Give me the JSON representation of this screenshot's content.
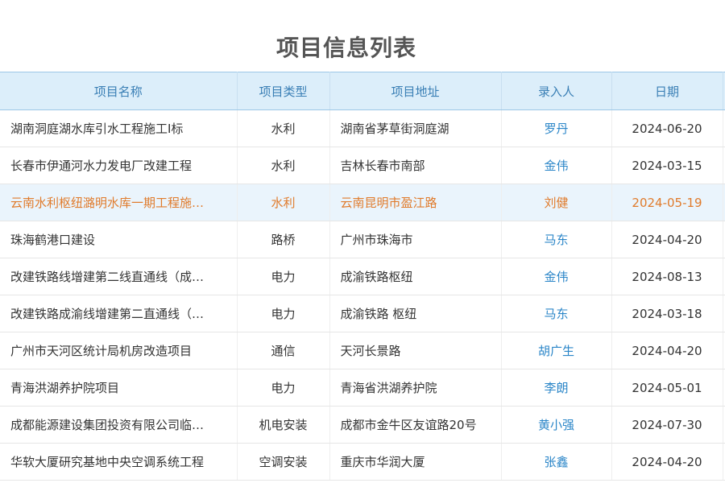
{
  "page": {
    "title": "项目信息列表"
  },
  "table": {
    "headers": [
      "项目名称",
      "项目类型",
      "项目地址",
      "录入人",
      "日期"
    ],
    "rows": [
      {
        "name": "湖南洞庭湖水库引水工程施工I标",
        "type": "水利",
        "address": "湖南省茅草街洞庭湖",
        "person": "罗丹",
        "date": "2024-06-20"
      },
      {
        "name": "长春市伊通河水力发电厂改建工程",
        "type": "水利",
        "address": "吉林长春市南部",
        "person": "金伟",
        "date": "2024-03-15"
      },
      {
        "name": "云南水利枢纽潞明水库一期工程施…",
        "type": "水利",
        "address": "云南昆明市盈江路",
        "person": "刘健",
        "date": "2024-05-19"
      },
      {
        "name": "珠海鹤港口建设",
        "type": "路桥",
        "address": "广州市珠海市",
        "person": "马东",
        "date": "2024-04-20"
      },
      {
        "name": "改建铁路线增建第二线直通线（成…",
        "type": "电力",
        "address": "成渝铁路枢纽",
        "person": "金伟",
        "date": "2024-08-13"
      },
      {
        "name": "改建铁路成渝线增建第二直通线（…",
        "type": "电力",
        "address": "成渝铁路 枢纽",
        "person": "马东",
        "date": "2024-03-18"
      },
      {
        "name": "广州市天河区统计局机房改造项目",
        "type": "通信",
        "address": "天河长景路",
        "person": "胡广生",
        "date": "2024-04-20"
      },
      {
        "name": "青海洪湖养护院项目",
        "type": "电力",
        "address": "青海省洪湖养护院",
        "person": "李朗",
        "date": "2024-05-01"
      },
      {
        "name": "成都能源建设集团投资有限公司临…",
        "type": "机电安装",
        "address": "成都市金牛区友谊路20号",
        "person": "黄小强",
        "date": "2024-07-30"
      },
      {
        "name": "华软大厦研究基地中央空调系统工程",
        "type": "空调安装",
        "address": "重庆市华润大厦",
        "person": "张鑫",
        "date": "2024-04-20"
      }
    ],
    "highlighted_row": 2
  },
  "colors": {
    "header_bg": "#dceefa",
    "header_text": "#3a7fb5",
    "person_link": "#2b86c8",
    "highlight_text": "#e07b2c",
    "highlight_bg": "#eaf4fc"
  }
}
